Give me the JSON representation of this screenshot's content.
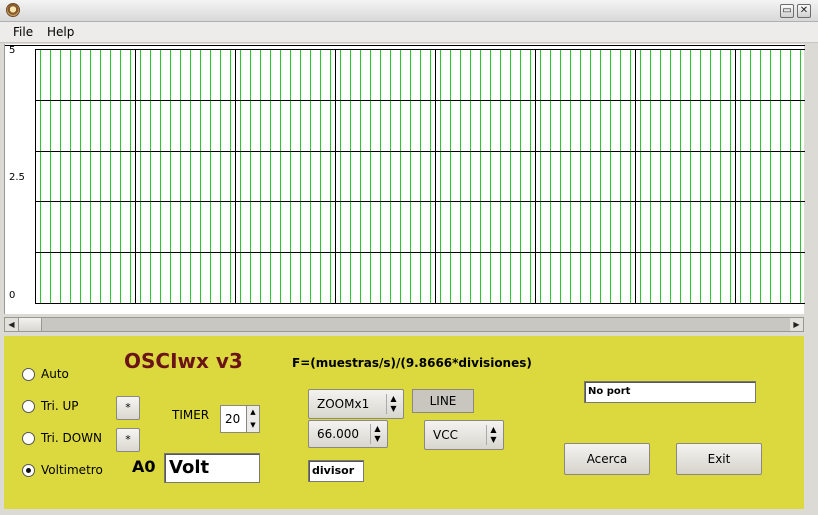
{
  "window": {
    "minimize_glyph": "▭",
    "close_glyph": "✕"
  },
  "menu": {
    "file": "File",
    "help": "Help"
  },
  "scope": {
    "y_labels": [
      "5",
      "2.5",
      "0"
    ],
    "trace_color": "#22cc22",
    "grid_color": "#000000"
  },
  "scrollbar": {
    "left_arrow": "◀",
    "right_arrow": "▶"
  },
  "modes": [
    {
      "label": "Auto",
      "checked": false
    },
    {
      "label": "Tri. UP",
      "checked": false
    },
    {
      "label": "Tri. DOWN",
      "checked": false
    },
    {
      "label": "Voltimetro",
      "checked": true
    }
  ],
  "trigger_buttons": {
    "up": "*",
    "down": "*"
  },
  "app_title": "OSCIwx v3",
  "formula": "F=(muestras/s)/(9.8666*divisiones)",
  "timer": {
    "label": "TIMER",
    "value": "20"
  },
  "channel": {
    "label": "A0",
    "volt_value": "Volt"
  },
  "zoom": {
    "value": "ZOOMx1"
  },
  "line_button": "LINE",
  "divisor_value": {
    "value": "66.000"
  },
  "vcc": {
    "value": "VCC"
  },
  "divisor_field": "divisor",
  "port_field": "No port",
  "buttons": {
    "about": "Acerca",
    "exit": "Exit"
  }
}
